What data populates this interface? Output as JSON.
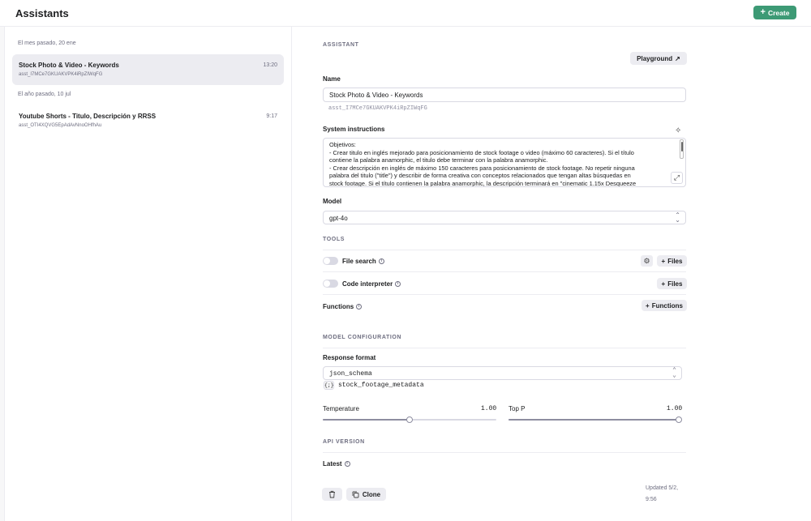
{
  "header": {
    "title": "Assistants",
    "create_label": "Create"
  },
  "sidebar": {
    "groups": [
      {
        "label": "El mes pasado, 20 ene",
        "items": [
          {
            "title": "Stock Photo & Video - Keywords",
            "id": "asst_I7MCe7GKUAKVPK4iRpZIWqFG",
            "time": "13:20",
            "selected": true
          }
        ]
      },
      {
        "label": "El año pasado, 10 jul",
        "items": [
          {
            "title": "Youtube Shorts - Titulo, Descripción y RRSS",
            "id": "asst_OTI4XQVG5EpAdAvNnoOHfhAu",
            "time": "9:17",
            "selected": false
          }
        ]
      }
    ]
  },
  "assistant": {
    "section_label": "ASSISTANT",
    "playground_label": "Playground",
    "name_label": "Name",
    "name_value": "Stock Photo & Video - Keywords",
    "assistant_id": "asst_I7MCe7GKUAKVPK4iRpZIWqFG",
    "instructions_label": "System instructions",
    "instructions_lines": [
      "Objetivos:",
      "- Crear titulo en inglés mejorado para posicionamiento de stock footage o video (máximo 60 caracteres). Si el título",
      "contiene la palabra anamorphic, el titulo debe terminar con la palabra anamorphic.",
      "- Crear descripción en inglés de máximo 150 caracteres para posicionamiento de stock footage. No repetir ninguna",
      "palabra del titulo (\"title\") y describir de forma creativa con conceptos relacionados que tengan altas búsquedas en",
      "stock footage. Si el título contienen la palabra anamorphic, la descripción terminará en \"cinematic 1.15x Desqueeze"
    ],
    "model_label": "Model",
    "model_value": "gpt-4o"
  },
  "tools": {
    "section_label": "TOOLS",
    "file_search_label": "File search",
    "code_interpreter_label": "Code interpreter",
    "functions_label": "Functions",
    "files_button_label": "Files",
    "functions_button_label": "Functions",
    "file_search_enabled": false,
    "code_interpreter_enabled": false
  },
  "model_config": {
    "section_label": "MODEL CONFIGURATION",
    "response_format_label": "Response format",
    "response_format_value": "json_schema",
    "schema_icon": "{;}",
    "schema_name": "stock_footage_metadata",
    "temperature_label": "Temperature",
    "temperature_value": "1.00",
    "temperature_fraction": 0.5,
    "top_p_label": "Top P",
    "top_p_value": "1.00",
    "top_p_fraction": 1.0
  },
  "api_version": {
    "section_label": "API VERSION",
    "latest_label": "Latest"
  },
  "footer": {
    "clone_label": "Clone",
    "updated_line1": "Updated 5/2,",
    "updated_line2": "9:56"
  },
  "colors": {
    "accent": "#3d9a75",
    "selected_bg": "#ececf1",
    "border": "#d9d9e3",
    "muted_text": "#6e6e80"
  }
}
